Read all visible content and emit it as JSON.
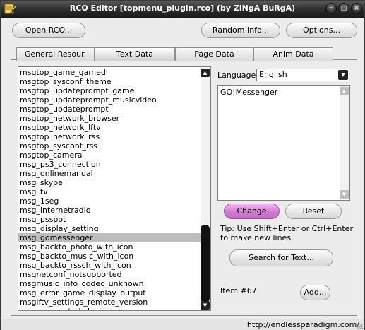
{
  "window": {
    "title": "RCO Editor [topmenu_plugin.rco] (by ZiNgA BuRgA)",
    "min_glyph": "−",
    "max_glyph": "□",
    "close_glyph": "×"
  },
  "toolbar": {
    "open_label": "Open RCO...",
    "random_info_label": "Random Info...",
    "options_label": "Options..."
  },
  "tabs": [
    {
      "label": "General Resour."
    },
    {
      "label": "Text Data",
      "active": true
    },
    {
      "label": "Page Data"
    },
    {
      "label": "Anim Data"
    }
  ],
  "list": {
    "items": [
      "msgtop_game_gamedl",
      "msgtop_sysconf_theme",
      "msgtop_updateprompt_game",
      "msgtop_updateprompt_musicvideo",
      "msgtop_updateprompt",
      "msgtop_network_browser",
      "msgtop_network_lftv",
      "msgtop_network_rss",
      "msgtop_sysconf_rss",
      "msgtop_camera",
      "msg_ps3_connection",
      "msg_onlinemanual",
      "msg_skype",
      "msg_tv",
      "msg_1seg",
      "msg_internetradio",
      "msg_psspot",
      "msg_display_setting",
      "msg_gomessenger",
      "msg_backto_photo_with_icon",
      "msg_backto_music_with_icon",
      "msg_backto_rssch_with_icon",
      "msgnetconf_notsupported",
      "msgmusic_info_codec_unknown",
      "msg_error_game_display_output",
      "msglftv_settings_remote_version",
      "msg_connected_device"
    ],
    "selected_index": 18,
    "scroll_up_glyph": "▲",
    "scroll_down_glyph": "▼"
  },
  "language": {
    "label": "Language:",
    "value": "English",
    "arrow_glyph": "▼"
  },
  "editor": {
    "text": "GO!Messenger",
    "scroll_up_glyph": "▲",
    "scroll_down_glyph": "▼"
  },
  "actions": {
    "change_label": "Change",
    "reset_label": "Reset",
    "tip": "Tip: Use Shift+Enter or Ctrl+Enter to make new lines.",
    "search_label": "Search for Text...",
    "item_label": "Item #67",
    "add_label": "Add..."
  },
  "status": {
    "text": "http://endlessparadigm.com/"
  },
  "colors": {
    "titlebar": "#2b2b2b",
    "accent_change": "#d07ad0",
    "selection": "#bdbdbd"
  }
}
